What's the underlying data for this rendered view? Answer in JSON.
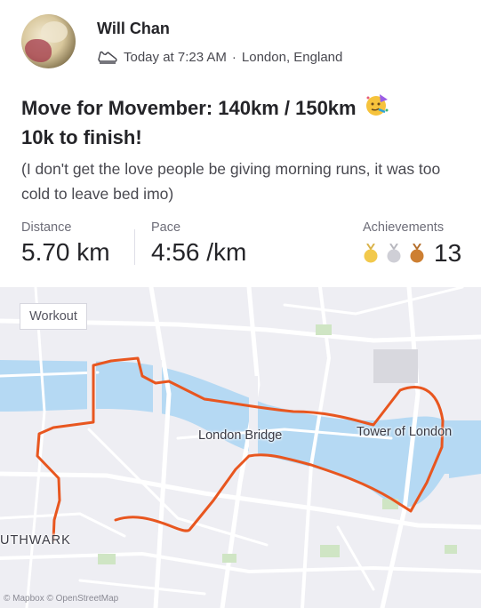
{
  "post": {
    "athlete_name": "Will Chan",
    "activity_icon": "shoe-icon",
    "time": "Today at 7:23 AM",
    "separator": "·",
    "location": "London, England",
    "title": "Move for Movember: 140km / 150km",
    "title_emoji": "party-face-icon",
    "title_line2": "10k to finish!",
    "description": "(I don't get the love people be giving morning runs, it was too cold to leave bed imo)"
  },
  "stats": {
    "distance_label": "Distance",
    "distance_value": "5.70 km",
    "pace_label": "Pace",
    "pace_value": "4:56 /km",
    "achievements_label": "Achievements",
    "achievements_count": "13",
    "medal_icons": [
      "gold-medal-icon",
      "silver-medal-icon",
      "bronze-medal-icon"
    ]
  },
  "map": {
    "workout_button": "Workout",
    "label_london_bridge": "London Bridge",
    "label_tower": "Tower of London",
    "label_southwark": "UTHWARK",
    "attribution": "© Mapbox © OpenStreetMap",
    "route_color": "#e8561f",
    "water_color": "#b5d9f3"
  }
}
